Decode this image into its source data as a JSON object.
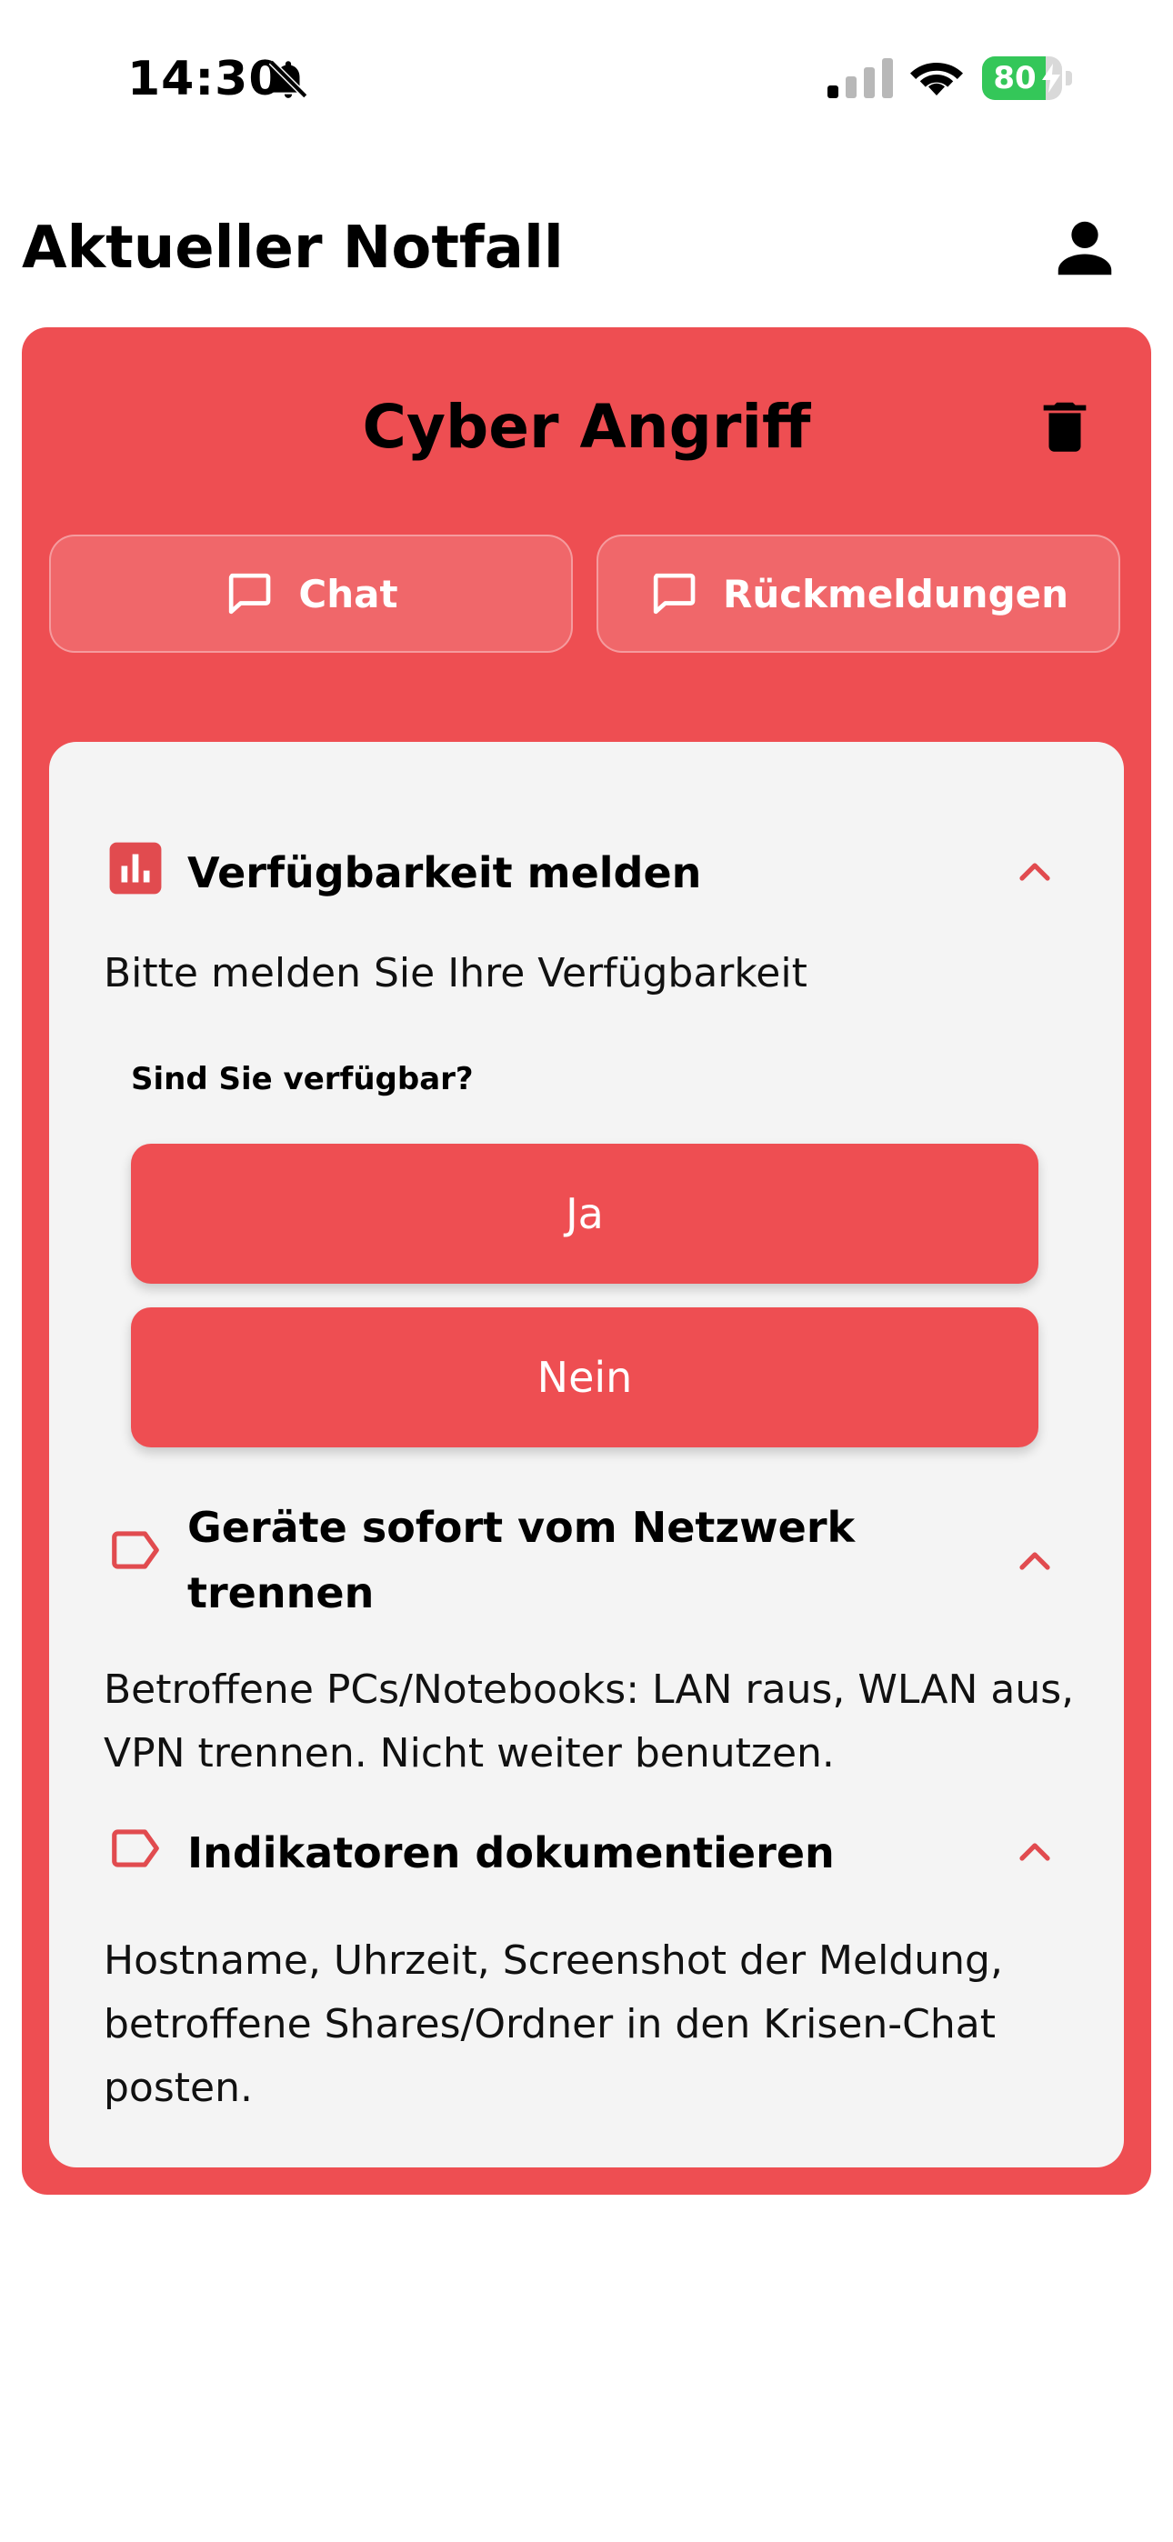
{
  "status_bar": {
    "time": "14:30",
    "battery_level": "80",
    "battery_fraction": 0.8,
    "icons": [
      "bell-slash-icon",
      "signal-icon",
      "wifi-icon",
      "battery-charging-icon"
    ]
  },
  "header": {
    "title": "Aktueller Notfall",
    "profile_icon": "person-icon"
  },
  "card": {
    "title": "Cyber Angriff",
    "color": "#ee4e52",
    "delete_icon": "trash-icon",
    "buttons": {
      "chat": "Chat",
      "feedback": "Rückmeldungen"
    }
  },
  "sections": [
    {
      "title": "Verfügbarkeit melden",
      "icon": "bar-chart-icon",
      "text": "Bitte melden Sie Ihre Verfügbarkeit",
      "question": "Sind Sie verfügbar?",
      "answers": [
        "Ja",
        "Nein"
      ]
    },
    {
      "title": "Geräte sofort vom Netzwerk trennen",
      "icon": "label-icon",
      "text": "Betroffene PCs/Notebooks: LAN raus, WLAN aus, VPN trennen. Nicht weiter benutzen."
    },
    {
      "title": "Indikatoren dokumentieren",
      "icon": "label-icon",
      "text": "Hostname, Uhrzeit, Screenshot der Meldung, betroffene Shares/Ordner in den Krisen-Chat posten."
    }
  ]
}
